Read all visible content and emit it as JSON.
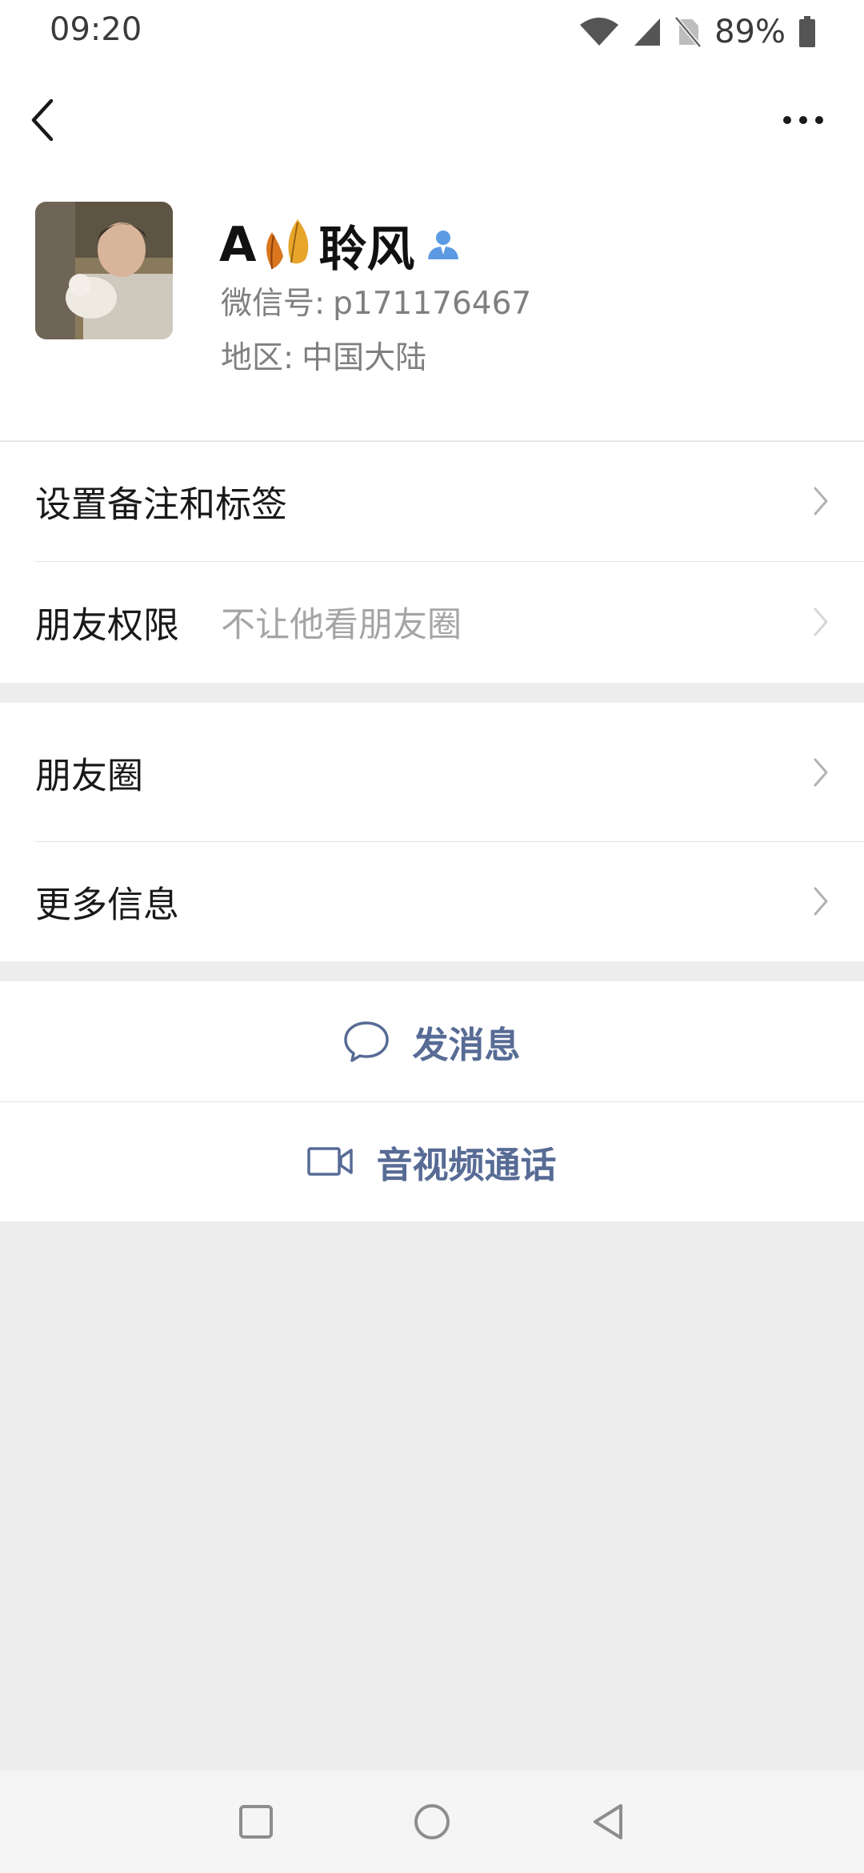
{
  "status_bar": {
    "time": "09:20",
    "battery": "89%",
    "icons": [
      "wifi-icon",
      "cell-signal-icon",
      "no-sim-icon",
      "battery-icon"
    ]
  },
  "nav": {
    "back_icon": "chevron-left-icon",
    "more_icon": "more-dots-icon"
  },
  "profile": {
    "name_prefix": "A",
    "name_emoji": "fallen-leaf",
    "name_suffix": "聆风",
    "wechat_id_label": "微信号:",
    "wechat_id": "p171176467",
    "region_label": "地区:",
    "region": "中国大陆"
  },
  "settings": {
    "remark_tags": "设置备注和标签",
    "friend_permission": "朋友权限",
    "friend_permission_value": "不让他看朋友圈"
  },
  "moments": {
    "moments_label": "朋友圈",
    "more_info_label": "更多信息"
  },
  "actions": {
    "send_message": "发消息",
    "video_call": "音视频通话"
  },
  "colors": {
    "accent_link": "#576b95",
    "background": "#ededed",
    "card": "#ffffff",
    "secondary_text": "#7f7f7f",
    "verified_blue": "#5c9be3"
  }
}
